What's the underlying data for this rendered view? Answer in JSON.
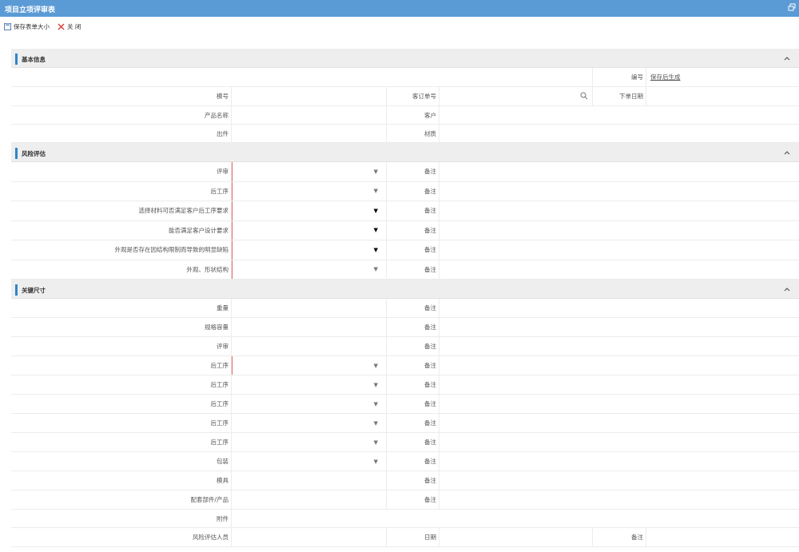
{
  "window": {
    "title": "项目立项评审表"
  },
  "toolbar": {
    "save_size": "保存表单大小",
    "close": "关 闭"
  },
  "sections": {
    "basic": "基本信息",
    "risk": "风险评估",
    "key": "关键尺寸"
  },
  "basic": {
    "number_label": "编号",
    "number_value": "保存后生成",
    "model_label": "模号",
    "order_label": "客订单号",
    "date_label": "下单日期",
    "product_label": "产品名称",
    "customer_label": "客户",
    "output_label": "出件",
    "material_label": "材质"
  },
  "risk_rows": [
    {
      "label": "评审",
      "remark": "备注",
      "arrow": "dark"
    },
    {
      "label": "后工序",
      "remark": "备注",
      "arrow": "light"
    },
    {
      "label": "选择材料可否满足客户后工序要求",
      "remark": "备注",
      "arrow": "dark"
    },
    {
      "label": "能否满足客户设计要求",
      "remark": "备注",
      "arrow": "dark"
    },
    {
      "label": "外观是否存在因结构限制而导致的明显缺陷",
      "remark": "备注",
      "arrow": "dark"
    },
    {
      "label": "外观、形状结构",
      "remark": "备注",
      "arrow": "light"
    }
  ],
  "key_rows": [
    {
      "label": "重量",
      "remark": "备注",
      "select": false
    },
    {
      "label": "规格容量",
      "remark": "备注",
      "select": false
    },
    {
      "label": "评审",
      "remark": "备注",
      "select": false,
      "clipped": true
    },
    {
      "label": "后工序",
      "remark": "备注",
      "select": true
    },
    {
      "label": "后工序",
      "remark": "备注",
      "select": true
    },
    {
      "label": "后工序",
      "remark": "备注",
      "select": true
    },
    {
      "label": "后工序",
      "remark": "备注",
      "select": true
    },
    {
      "label": "后工序",
      "remark": "备注",
      "select": true
    },
    {
      "label": "包装",
      "remark": "备注",
      "select": true
    },
    {
      "label": "模具",
      "remark": "备注",
      "select": false
    },
    {
      "label": "配套部件/产品",
      "remark": "备注",
      "select": false
    }
  ],
  "footer": {
    "attachment_label": "附件",
    "assessor_label": "风险评估人员",
    "date_label": "日期",
    "remark_label": "备注"
  },
  "icons": {
    "restore": "window-restore-icon",
    "save": "save-icon",
    "close": "close-x-icon",
    "collapse": "chevron-up-icon",
    "search": "search-icon"
  }
}
